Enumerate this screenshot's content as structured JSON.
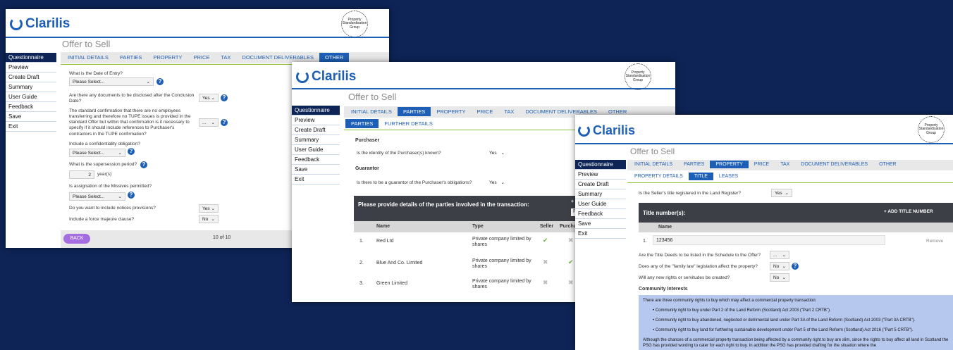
{
  "brand": {
    "name": "Clarilis",
    "psg": "Property Standardisation Group"
  },
  "page_title": "Offer to Sell",
  "sidebar": [
    "Questionnaire",
    "Preview",
    "Create Draft",
    "Summary",
    "User Guide",
    "Feedback",
    "Save",
    "Exit"
  ],
  "tabs": [
    "INITIAL DETAILS",
    "PARTIES",
    "PROPERTY",
    "PRICE",
    "TAX",
    "DOCUMENT DELIVERABLES",
    "OTHER"
  ],
  "s1": {
    "q1": "What is the Date of Entry?",
    "q1_sel": "Please Select...",
    "q2": "Are there any documents to be disclosed after the Conclusion Date?",
    "q2_sel": "Yes",
    "q3": "The standard confirmation that there are no employees transferring and therefore no TUPE issues is provided in the standard Offer but within that confirmation is it necessary to specify if it should include references to Purchaser's contractors in the TUPE confirmation?",
    "q3_sel": "...",
    "q4": "Include a confidentiality obligation?",
    "q4_sel": "Please Select...",
    "q5": "What is the supersession period?",
    "q5_val": "2",
    "q5_unit": "year(s)",
    "q6": "Is assignation of the Missives permitted?",
    "q6_sel": "Please Select...",
    "q7": "Do you want to include notices provisions?",
    "q7_sel": "Yes",
    "q8": "Include a force majeure clause?",
    "q8_sel": "No",
    "back": "BACK",
    "pager": "10 of 10"
  },
  "s2": {
    "subtabs": [
      "PARTIES",
      "FURTHER DETAILS"
    ],
    "purchaser_h": "Purchaser",
    "purchaser_q": "Is the identity of the Purchaser(s) known?",
    "purchaser_sel": "Yes",
    "guarantor_h": "Guarantor",
    "guarantor_q": "Is there to be a guarantor of the Purchaser's obligations?",
    "guarantor_sel": "Yes",
    "table_title": "Please provide details of the parties involved in the transaction:",
    "table_add": "+ A",
    "table_pl": "Pl",
    "cols": [
      "Name",
      "Type",
      "Seller",
      "Purcha"
    ],
    "rows": [
      {
        "n": "1.",
        "name": "Red Ltd",
        "type": "Private company limited by shares",
        "seller": "✔",
        "purch": "✖"
      },
      {
        "n": "2.",
        "name": "Blue And Co. Limited",
        "type": "Private company limited by shares",
        "seller": "✖",
        "purch": "✔"
      },
      {
        "n": "3.",
        "name": "Green Limited",
        "type": "Private company limited by shares",
        "seller": "✖",
        "purch": "✖"
      }
    ]
  },
  "s3": {
    "subtabs": [
      "PROPERTY DETAILS",
      "TITLE",
      "LEASES"
    ],
    "q1": "Is the Seller's title registered in the Land Register?",
    "q1_sel": "Yes",
    "title_h": "Title number(s):",
    "add_title": "+ ADD TITLE NUMBER",
    "name_col": "Name",
    "row_n": "1.",
    "row_val": "123456",
    "remove": "Remove",
    "q2": "Are the Title Deeds to be listed in the Schedule to the Offer?",
    "q2_sel": "...",
    "q3": "Does any of the \"family law\" legislation affect the property?",
    "q3_sel": "No",
    "q4": "Will any new rights or servitudes be created?",
    "q4_sel": "No",
    "ci_h": "Community Interests",
    "ci_intro": "There are three community rights to buy which may affect a commercial property transaction:",
    "ci_b1": "Community right to buy under Part 2 of the Land Reform (Scotland) Act 2003 (\"Part 2 CRTB\").",
    "ci_b2": "Community right to buy abandoned, neglected or detrimental land under Part 3A of the Land Reform (Scotland) Act 2003 (\"Part 3A CRTB\").",
    "ci_b3": "Community right to buy land for furthering sustainable development under Part 5 of the Land Reform (Scotland) Act 2016 (\"Part 5 CRTB\").",
    "ci_tail": "Although the chances of a commercial property transaction being affected by a community right to buy are slim, since the rights to buy affect all land in Scotland the PSG has provided wording to cater for each right to buy. In addition the PSG has provided drafting for the situation where the"
  }
}
